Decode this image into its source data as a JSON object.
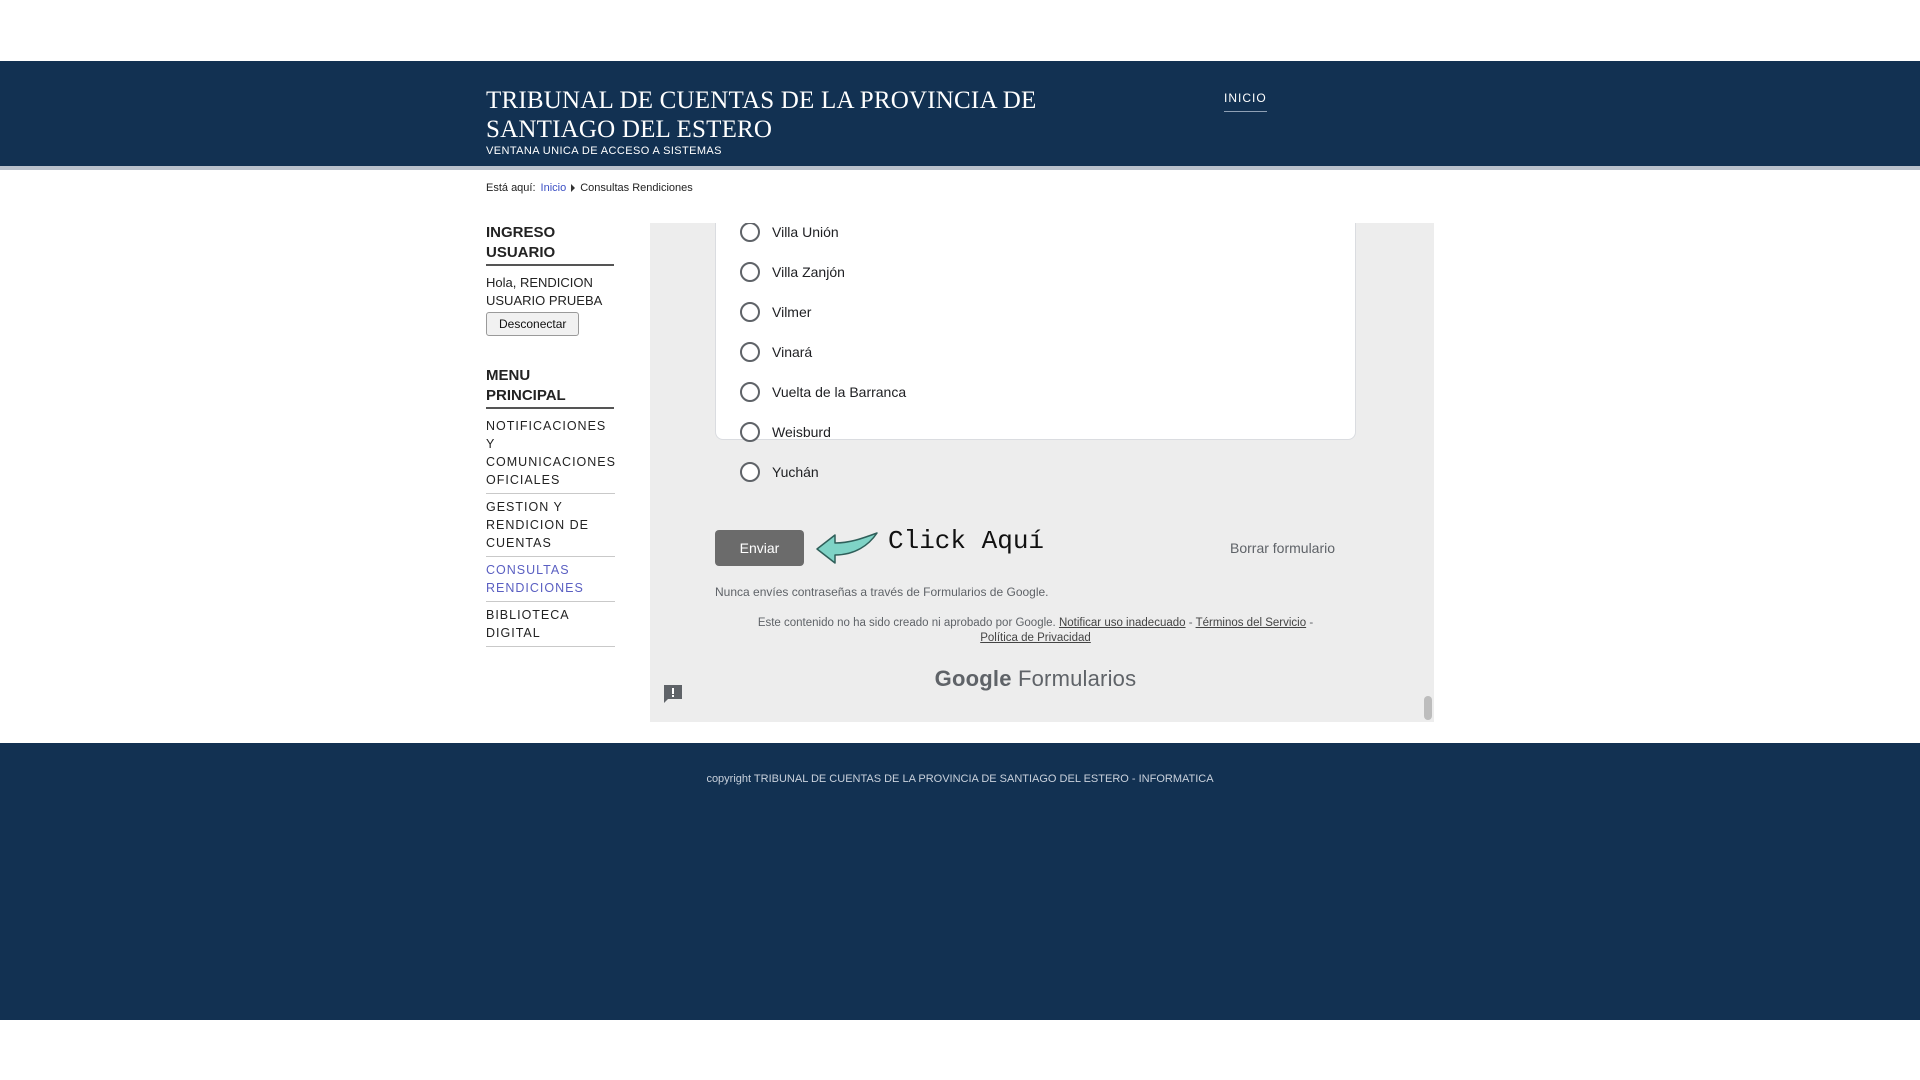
{
  "header": {
    "title": "TRIBUNAL DE CUENTAS DE LA PROVINCIA DE SANTIAGO DEL ESTERO",
    "subtitle": "VENTANA UNICA DE ACCESO A SISTEMAS",
    "nav_inicio": "INICIO",
    "background_color": "#123152"
  },
  "breadcrumb": {
    "prefix": "Está aquí:",
    "home": "Inicio",
    "current": "Consultas Rendiciones"
  },
  "sidebar": {
    "login_heading": "INGRESO USUARIO",
    "greeting": "Hola, RENDICION USUARIO PRUEBA",
    "logout_label": "Desconectar",
    "menu_heading": "MENU PRINCIPAL",
    "menu_items": [
      {
        "label": "NOTIFICACIONES Y COMUNICACIONES OFICIALES"
      },
      {
        "label": "GESTION Y RENDICION DE CUENTAS"
      },
      {
        "label": "CONSULTAS RENDICIONES"
      },
      {
        "label": "BIBLIOTECA DIGITAL"
      }
    ]
  },
  "form": {
    "options": [
      {
        "label": "Villa Unión"
      },
      {
        "label": "Villa Zanjón"
      },
      {
        "label": "Vilmer"
      },
      {
        "label": "Vinará"
      },
      {
        "label": "Vuelta de la Barranca"
      },
      {
        "label": "Weisburd"
      },
      {
        "label": "Yuchán"
      }
    ],
    "submit_label": "Enviar",
    "click_hint": "Click Aquí",
    "clear_label": "Borrar formulario",
    "password_notice": "Nunca envíes contraseñas a través de Formularios de Google.",
    "disclaimer_text": "Este contenido no ha sido creado ni aprobado por Google.",
    "report_link": "Notificar uso inadecuado",
    "terms_link": "Términos del Servicio",
    "privacy_link": "Política de Privacidad",
    "logo_google": "Google",
    "logo_forms": "Formularios",
    "arrow_icon": "arrow-left-icon",
    "report_icon": "feedback-icon"
  },
  "footer": {
    "copyright": "copyright TRIBUNAL DE CUENTAS DE LA PROVINCIA DE SANTIAGO DEL ESTERO - INFORMATICA"
  }
}
